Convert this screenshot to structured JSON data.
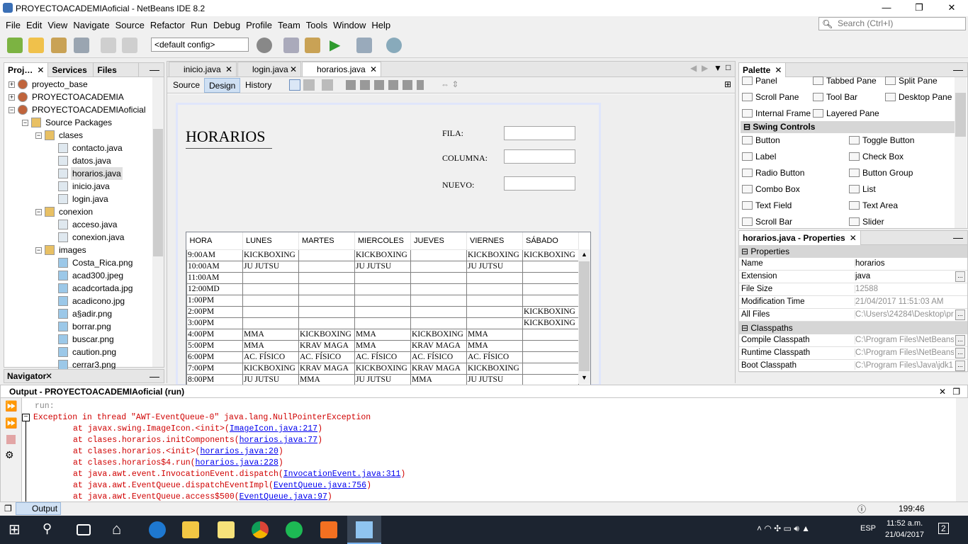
{
  "window": {
    "title": "PROYECTOACADEMIAoficial - NetBeans IDE 8.2",
    "minimize": "—",
    "maximize": "❐",
    "close": "✕"
  },
  "menu": [
    "File",
    "Edit",
    "View",
    "Navigate",
    "Source",
    "Refactor",
    "Run",
    "Debug",
    "Profile",
    "Team",
    "Tools",
    "Window",
    "Help"
  ],
  "search": {
    "placeholder": "Search (Ctrl+I)"
  },
  "toolbar": {
    "config": "<default config>"
  },
  "projects": {
    "tabs": [
      "Proj…",
      "Services",
      "Files"
    ],
    "tree": [
      {
        "label": "proyecto_base",
        "level": 0,
        "type": "project",
        "exp": "+"
      },
      {
        "label": "PROYECTOACADEMIA",
        "level": 0,
        "type": "project-error",
        "exp": "+"
      },
      {
        "label": "PROYECTOACADEMIAoficial",
        "level": 0,
        "type": "project",
        "exp": "−"
      },
      {
        "label": "Source Packages",
        "level": 1,
        "type": "source",
        "exp": "−"
      },
      {
        "label": "clases",
        "level": 2,
        "type": "package",
        "exp": "−"
      },
      {
        "label": "contacto.java",
        "level": 3,
        "type": "form"
      },
      {
        "label": "datos.java",
        "level": 3,
        "type": "form"
      },
      {
        "label": "horarios.java",
        "level": 3,
        "type": "form",
        "selected": true
      },
      {
        "label": "inicio.java",
        "level": 3,
        "type": "form"
      },
      {
        "label": "login.java",
        "level": 3,
        "type": "form"
      },
      {
        "label": "conexion",
        "level": 2,
        "type": "package",
        "exp": "−"
      },
      {
        "label": "acceso.java",
        "level": 3,
        "type": "class"
      },
      {
        "label": "conexion.java",
        "level": 3,
        "type": "class"
      },
      {
        "label": "images",
        "level": 2,
        "type": "package",
        "exp": "−"
      },
      {
        "label": "Costa_Rica.png",
        "level": 3,
        "type": "image"
      },
      {
        "label": "acad300.jpeg",
        "level": 3,
        "type": "image"
      },
      {
        "label": "acadcortada.jpg",
        "level": 3,
        "type": "image"
      },
      {
        "label": "acadicono.jpg",
        "level": 3,
        "type": "image"
      },
      {
        "label": "a§adir.png",
        "level": 3,
        "type": "image"
      },
      {
        "label": "borrar.png",
        "level": 3,
        "type": "image"
      },
      {
        "label": "buscar.png",
        "level": 3,
        "type": "image"
      },
      {
        "label": "caution.png",
        "level": 3,
        "type": "image"
      },
      {
        "label": "cerrar3.png",
        "level": 3,
        "type": "image"
      }
    ]
  },
  "navigator": {
    "title": "Navigator"
  },
  "editor": {
    "tabs": [
      "inicio.java",
      "login.java",
      "horarios.java"
    ],
    "active_tab": 2,
    "modes": [
      "Source",
      "Design",
      "History"
    ],
    "active_mode": "Design"
  },
  "form": {
    "title": "HORARIOS",
    "fields": [
      {
        "label": "FILA:",
        "value": ""
      },
      {
        "label": "COLUMNA:",
        "value": ""
      },
      {
        "label": "NUEVO:",
        "value": ""
      }
    ],
    "table": {
      "columns": [
        "HORA",
        "LUNES",
        "MARTES",
        "MIERCOLES",
        "JUEVES",
        "VIERNES",
        "SÁBADO"
      ],
      "rows": [
        [
          "9:00AM",
          "KICKBOXING",
          "",
          "KICKBOXING",
          "",
          "KICKBOXING",
          "KICKBOXING"
        ],
        [
          "10:00AM",
          "JU JUTSU",
          "",
          "JU JUTSU",
          "",
          "JU JUTSU",
          ""
        ],
        [
          "11:00AM",
          "",
          "",
          "",
          "",
          "",
          ""
        ],
        [
          "12:00MD",
          "",
          "",
          "",
          "",
          "",
          ""
        ],
        [
          "1:00PM",
          "",
          "",
          "",
          "",
          "",
          ""
        ],
        [
          "2:00PM",
          "",
          "",
          "",
          "",
          "",
          "KICKBOXING"
        ],
        [
          "3:00PM",
          "",
          "",
          "",
          "",
          "",
          "KICKBOXING"
        ],
        [
          "4:00PM",
          "MMA",
          "KICKBOXING",
          "MMA",
          "KICKBOXING",
          "MMA",
          ""
        ],
        [
          "5:00PM",
          "MMA",
          "KRAV MAGA",
          "MMA",
          "KRAV MAGA",
          "MMA",
          ""
        ],
        [
          "6:00PM",
          "AC. FÍSICO",
          "AC. FÍSICO",
          "AC. FÍSICO",
          "AC. FÍSICO",
          "AC. FÍSICO",
          ""
        ],
        [
          "7:00PM",
          "KICKBOXING",
          "KRAV MAGA",
          "KICKBOXING",
          "KRAV MAGA",
          "KICKBOXING",
          ""
        ],
        [
          "8:00PM",
          "JU JUTSU",
          "MMA",
          "JU JUTSU",
          "MMA",
          "JU JUTSU",
          ""
        ]
      ]
    }
  },
  "palette": {
    "title": "Palette",
    "containers": [
      "Panel",
      "Tabbed Pane",
      "Split Pane",
      "Scroll Pane",
      "Tool Bar",
      "Desktop Pane",
      "Internal Frame",
      "Layered Pane"
    ],
    "category": "Swing Controls",
    "controls": [
      "Button",
      "Toggle Button",
      "Label",
      "Check Box",
      "Radio Button",
      "Button Group",
      "Combo Box",
      "List",
      "Text Field",
      "Text Area",
      "Scroll Bar",
      "Slider"
    ]
  },
  "properties": {
    "title": "horarios.java - Properties",
    "sections": [
      {
        "name": "Properties",
        "rows": [
          {
            "key": "Name",
            "value": "horarios",
            "editable": true,
            "dots": false
          },
          {
            "key": "Extension",
            "value": "java",
            "editable": true,
            "dots": true
          },
          {
            "key": "File Size",
            "value": "12588",
            "editable": false,
            "dots": false
          },
          {
            "key": "Modification Time",
            "value": "21/04/2017 11:51:03 AM",
            "editable": false,
            "dots": false
          },
          {
            "key": "All Files",
            "value": "C:\\Users\\24284\\Desktop\\pr...",
            "editable": false,
            "dots": true
          }
        ]
      },
      {
        "name": "Classpaths",
        "rows": [
          {
            "key": "Compile Classpath",
            "value": "C:\\Program Files\\NetBeans ...",
            "editable": false,
            "dots": true
          },
          {
            "key": "Runtime Classpath",
            "value": "C:\\Program Files\\NetBeans ...",
            "editable": false,
            "dots": true
          },
          {
            "key": "Boot Classpath",
            "value": "C:\\Program Files\\Java\\jdk1....",
            "editable": false,
            "dots": true
          }
        ]
      }
    ]
  },
  "output": {
    "title": "Output - PROYECTOACADEMIAoficial (run)",
    "run_line": "run:",
    "exception": "Exception in thread \"AWT-EventQueue-0\" java.lang.NullPointerException",
    "stack": [
      {
        "text": "at javax.swing.ImageIcon.<init>",
        "link": "ImageIcon.java:217"
      },
      {
        "text": "at clases.horarios.initComponents",
        "link": "horarios.java:77"
      },
      {
        "text": "at clases.horarios.<init>",
        "link": "horarios.java:20"
      },
      {
        "text": "at clases.horarios$4.run",
        "link": "horarios.java:228"
      },
      {
        "text": "at java.awt.event.InvocationEvent.dispatch",
        "link": "InvocationEvent.java:311"
      },
      {
        "text": "at java.awt.EventQueue.dispatchEventImpl",
        "link": "EventQueue.java:756"
      },
      {
        "text": "at java.awt.EventQueue.access$500",
        "link": "EventQueue.java:97"
      }
    ]
  },
  "statusbar": {
    "output_tab": "Output",
    "position": "199:46"
  },
  "taskbar": {
    "time": "11:52 a.m.",
    "date": "21/04/2017",
    "lang": "ESP",
    "notifications": "2"
  }
}
